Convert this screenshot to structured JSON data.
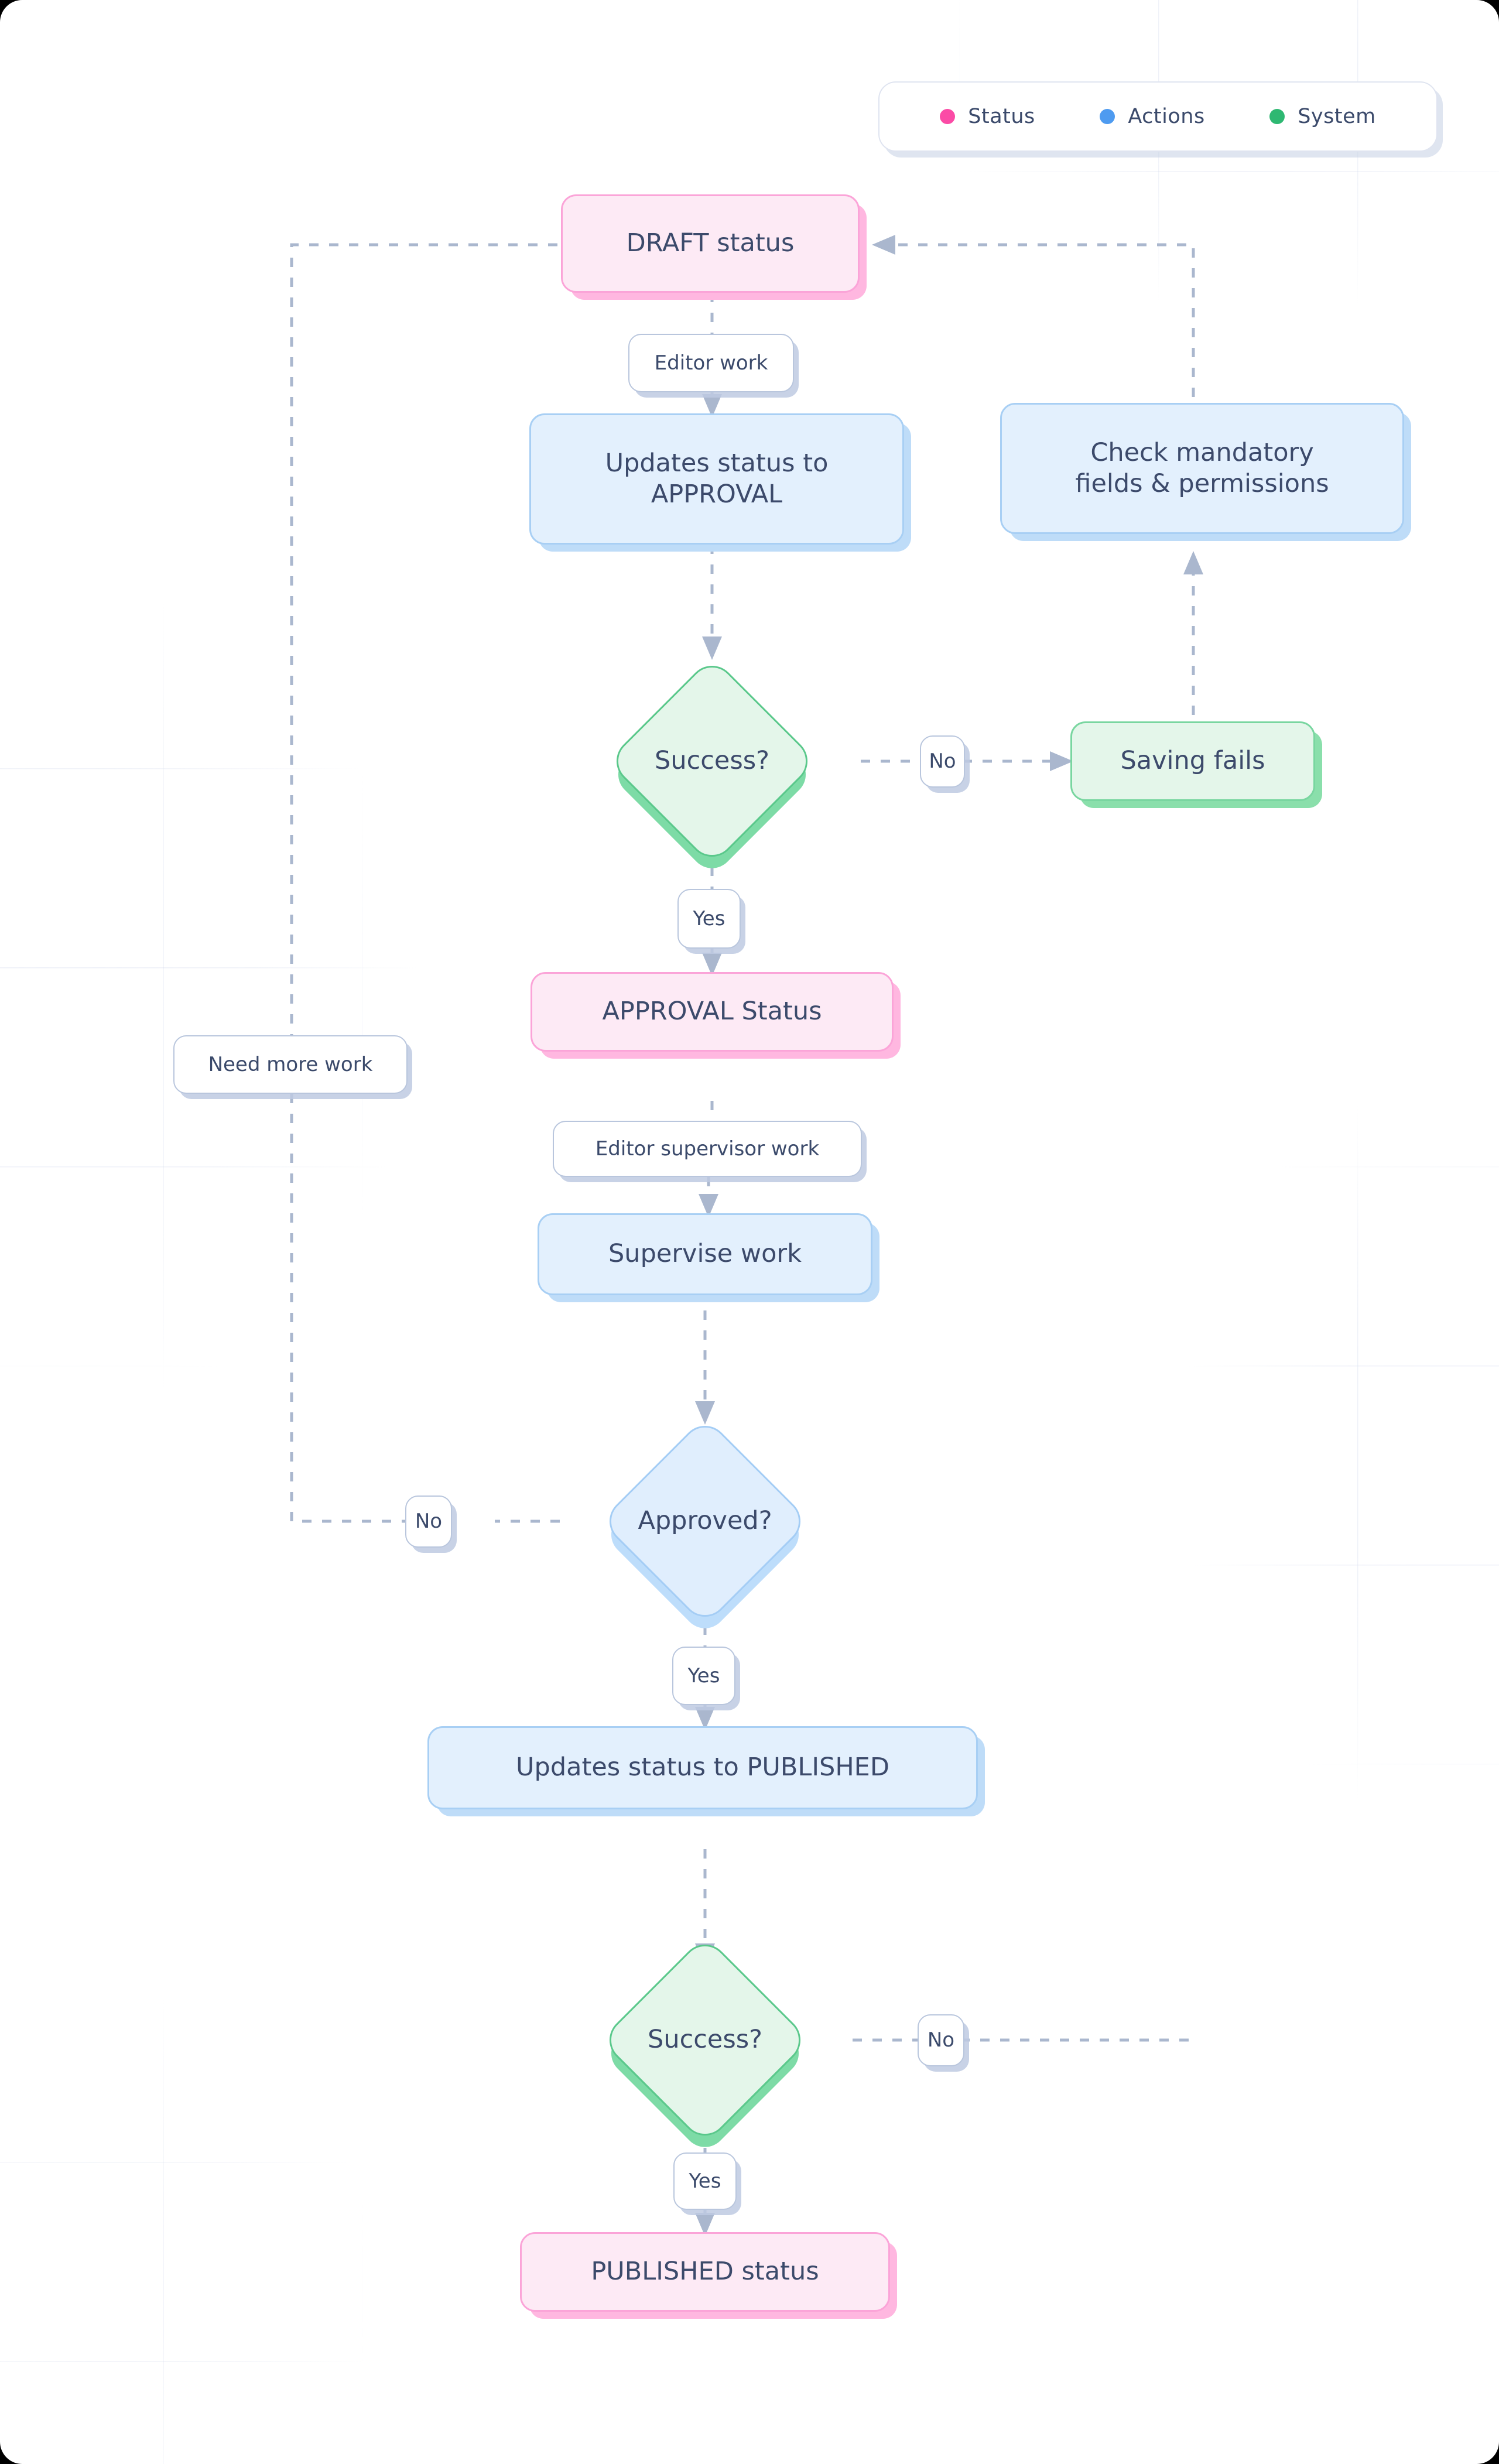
{
  "legend": {
    "items": [
      {
        "label": "Status",
        "color": "#fb4ba6",
        "icon": "dot-icon"
      },
      {
        "label": "Actions",
        "color": "#4e9bf0",
        "icon": "dot-icon"
      },
      {
        "label": "System",
        "color": "#2eb872",
        "icon": "dot-icon"
      }
    ]
  },
  "nodes": {
    "draft_status": "DRAFT status",
    "updates_approval": "Updates status to\nAPPROVAL",
    "check_mandatory": "Check mandatory\nfields & permissions",
    "success_1": "Success?",
    "saving_fails": "Saving fails",
    "approval_status": "APPROVAL Status",
    "supervise_work": "Supervise work",
    "approved": "Approved?",
    "updates_published": "Updates status to PUBLISHED",
    "success_2": "Success?",
    "published_status": "PUBLISHED status"
  },
  "edge_labels": {
    "editor_work": "Editor work",
    "no_1": "No",
    "yes_1": "Yes",
    "need_more_work": "Need more work",
    "editor_supervisor_work": "Editor supervisor work",
    "no_2": "No",
    "yes_2": "Yes",
    "no_3": "No",
    "yes_3": "Yes"
  },
  "colors": {
    "status_fill": "#fdeaf5",
    "status_border": "#fba4d8",
    "action_fill": "#e3f0fd",
    "action_border": "#a8cff4",
    "system_fill": "#e4f6ea",
    "system_border": "#79d6a0",
    "text": "#3c4a6b",
    "edge": "#aab7ce"
  }
}
